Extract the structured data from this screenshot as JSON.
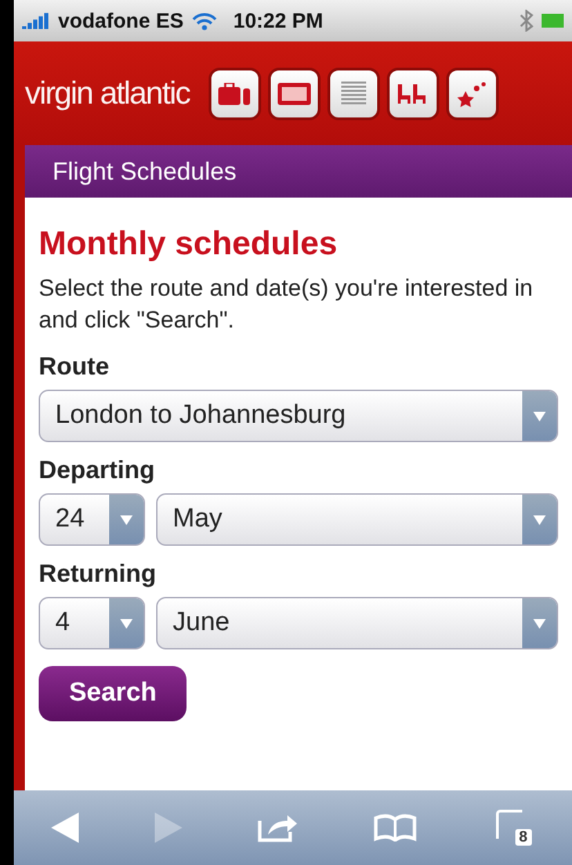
{
  "status_bar": {
    "carrier": "vodafone ES",
    "time": "10:22 PM"
  },
  "header": {
    "logo": "virgin atlantic",
    "nav_icons": [
      {
        "kind": "suitcase"
      },
      {
        "kind": "ticket"
      },
      {
        "kind": "list"
      },
      {
        "kind": "seats"
      },
      {
        "kind": "stars"
      }
    ]
  },
  "section_bar": {
    "title": "Flight Schedules"
  },
  "page": {
    "heading": "Monthly schedules",
    "intro": "Select the route and date(s) you're interested in and click \"Search\".",
    "fields": [
      {
        "label": "Route",
        "selects": [
          {
            "value": "London to Johannesburg",
            "kind": "wide"
          }
        ]
      },
      {
        "label": "Departing",
        "selects": [
          {
            "value": "24",
            "kind": "day"
          },
          {
            "value": "May",
            "kind": "wide"
          }
        ]
      },
      {
        "label": "Returning",
        "selects": [
          {
            "value": "4",
            "kind": "day"
          },
          {
            "value": "June",
            "kind": "wide"
          }
        ]
      }
    ],
    "search_button": "Search"
  },
  "browser_toolbar": {
    "back_disabled": false,
    "forward_disabled": true,
    "tab_count": "8"
  }
}
